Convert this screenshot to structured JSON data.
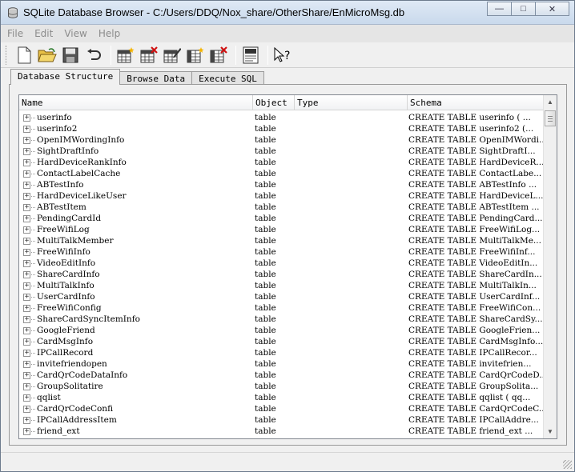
{
  "window": {
    "title": "SQLite Database Browser - C:/Users/DDQ/Nox_share/OtherShare/EnMicroMsg.db",
    "buttons": {
      "minimize": "—",
      "maximize": "□",
      "close": "✕"
    }
  },
  "menu": [
    "File",
    "Edit",
    "View",
    "Help"
  ],
  "toolbar": {
    "icons": [
      "new-file-icon",
      "open-folder-icon",
      "save-icon",
      "undo-icon",
      "create-table-icon",
      "delete-table-icon",
      "modify-table-icon",
      "create-index-icon",
      "delete-index-icon",
      "log-icon",
      "whats-this-icon"
    ],
    "log_label": "LOG"
  },
  "tabs": [
    "Database Structure",
    "Browse Data",
    "Execute SQL"
  ],
  "active_tab": "Database Structure",
  "table": {
    "columns": [
      "Name",
      "Object",
      "Type",
      "Schema"
    ],
    "rows": [
      {
        "name": "userinfo",
        "object": "table",
        "type": "",
        "schema": "CREATE TABLE userinfo ( ..."
      },
      {
        "name": "userinfo2",
        "object": "table",
        "type": "",
        "schema": "CREATE TABLE userinfo2 (..."
      },
      {
        "name": "OpenIMWordingInfo",
        "object": "table",
        "type": "",
        "schema": "CREATE TABLE OpenIMWordi..."
      },
      {
        "name": "SightDraftInfo",
        "object": "table",
        "type": "",
        "schema": "CREATE TABLE SightDraftI..."
      },
      {
        "name": "HardDeviceRankInfo",
        "object": "table",
        "type": "",
        "schema": "CREATE TABLE HardDeviceR..."
      },
      {
        "name": "ContactLabelCache",
        "object": "table",
        "type": "",
        "schema": "CREATE TABLE ContactLabe..."
      },
      {
        "name": "ABTestInfo",
        "object": "table",
        "type": "",
        "schema": "CREATE TABLE ABTestInfo ..."
      },
      {
        "name": "HardDeviceLikeUser",
        "object": "table",
        "type": "",
        "schema": "CREATE TABLE HardDeviceL..."
      },
      {
        "name": "ABTestItem",
        "object": "table",
        "type": "",
        "schema": "CREATE TABLE ABTestItem ..."
      },
      {
        "name": "PendingCardId",
        "object": "table",
        "type": "",
        "schema": "CREATE TABLE PendingCard..."
      },
      {
        "name": "FreeWifiLog",
        "object": "table",
        "type": "",
        "schema": "CREATE TABLE FreeWifiLog..."
      },
      {
        "name": "MultiTalkMember",
        "object": "table",
        "type": "",
        "schema": "CREATE TABLE MultiTalkMe..."
      },
      {
        "name": "FreeWifiInfo",
        "object": "table",
        "type": "",
        "schema": "CREATE TABLE FreeWifiInf..."
      },
      {
        "name": "VideoEditInfo",
        "object": "table",
        "type": "",
        "schema": "CREATE TABLE VideoEditIn..."
      },
      {
        "name": "ShareCardInfo",
        "object": "table",
        "type": "",
        "schema": "CREATE TABLE ShareCardIn..."
      },
      {
        "name": "MultiTalkInfo",
        "object": "table",
        "type": "",
        "schema": "CREATE TABLE MultiTalkIn..."
      },
      {
        "name": "UserCardInfo",
        "object": "table",
        "type": "",
        "schema": "CREATE TABLE UserCardInf..."
      },
      {
        "name": "FreeWifiConfig",
        "object": "table",
        "type": "",
        "schema": "CREATE TABLE FreeWifiCon..."
      },
      {
        "name": "ShareCardSyncItemInfo",
        "object": "table",
        "type": "",
        "schema": "CREATE TABLE ShareCardSy..."
      },
      {
        "name": "GoogleFriend",
        "object": "table",
        "type": "",
        "schema": "CREATE TABLE GoogleFrien..."
      },
      {
        "name": "CardMsgInfo",
        "object": "table",
        "type": "",
        "schema": "CREATE TABLE CardMsgInfo..."
      },
      {
        "name": "IPCallRecord",
        "object": "table",
        "type": "",
        "schema": "CREATE TABLE IPCallRecor..."
      },
      {
        "name": "invitefriendopen",
        "object": "table",
        "type": "",
        "schema": "CREATE TABLE invitefrien..."
      },
      {
        "name": "CardQrCodeDataInfo",
        "object": "table",
        "type": "",
        "schema": "CREATE TABLE CardQrCodeD..."
      },
      {
        "name": "GroupSolitatire",
        "object": "table",
        "type": "",
        "schema": "CREATE TABLE GroupSolita..."
      },
      {
        "name": "qqlist",
        "object": "table",
        "type": "",
        "schema": "CREATE TABLE qqlist ( qq..."
      },
      {
        "name": "CardQrCodeConfi",
        "object": "table",
        "type": "",
        "schema": "CREATE TABLE CardQrCodeC..."
      },
      {
        "name": "IPCallAddressItem",
        "object": "table",
        "type": "",
        "schema": "CREATE TABLE IPCallAddre..."
      },
      {
        "name": "friend_ext",
        "object": "table",
        "type": "",
        "schema": "CREATE TABLE friend_ext ..."
      }
    ]
  },
  "expander_glyph": "+",
  "scroll": {
    "up": "▲",
    "down": "▼"
  }
}
